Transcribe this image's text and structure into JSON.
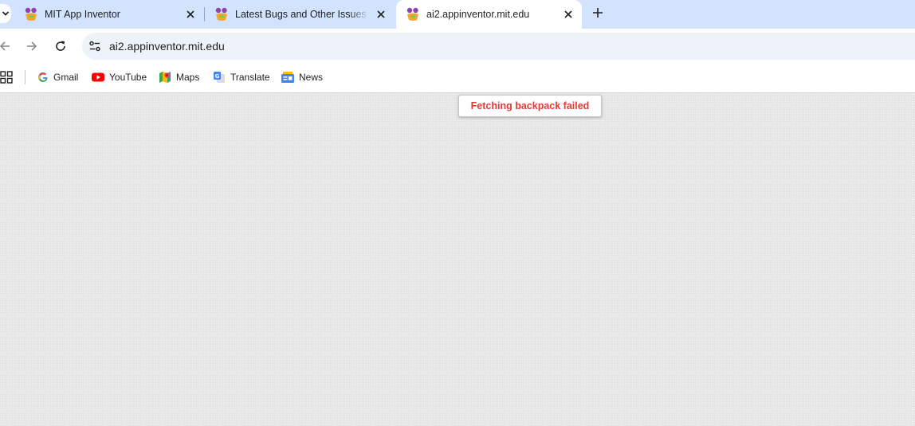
{
  "browser": {
    "tabs": [
      {
        "title": "MIT App Inventor",
        "active": false,
        "favicon": "app-inventor-icon"
      },
      {
        "title": "Latest Bugs and Other Issues to",
        "active": false,
        "favicon": "app-inventor-icon"
      },
      {
        "title": "ai2.appinventor.mit.edu",
        "active": true,
        "favicon": "app-inventor-icon"
      }
    ],
    "address_bar": {
      "url": "ai2.appinventor.mit.edu"
    },
    "bookmarks": [
      {
        "label": "Gmail",
        "icon": "google-icon"
      },
      {
        "label": "YouTube",
        "icon": "youtube-icon"
      },
      {
        "label": "Maps",
        "icon": "maps-icon"
      },
      {
        "label": "Translate",
        "icon": "translate-icon"
      },
      {
        "label": "News",
        "icon": "news-icon"
      }
    ]
  },
  "page": {
    "toast_message": "Fetching backpack failed"
  },
  "colors": {
    "tabstrip_bg": "#d3e3fd",
    "omnibox_bg": "#eef2f9",
    "error_text": "#e53935"
  }
}
